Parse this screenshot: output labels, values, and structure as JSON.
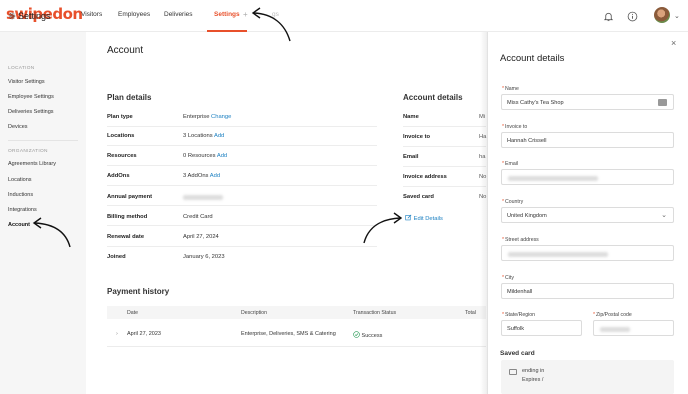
{
  "app": {
    "logo": "swipedon"
  },
  "topnav": {
    "items": [
      "Visitors",
      "Employees",
      "Deliveries",
      "Settings"
    ],
    "active": "Settings",
    "plus": "+",
    "extra": "gs"
  },
  "sidebar": {
    "title": "Settings",
    "sections": [
      {
        "heading": "LOCATION",
        "items": [
          "Visitor Settings",
          "Employee Settings",
          "Deliveries Settings",
          "Devices"
        ]
      },
      {
        "heading": "ORGANIZATION",
        "items": [
          "Agreements Library",
          "Locations",
          "Inductions",
          "Integrations",
          "Account"
        ]
      }
    ],
    "active": "Account"
  },
  "page": {
    "title": "Account"
  },
  "plan": {
    "heading": "Plan details",
    "rows": [
      {
        "label": "Plan type",
        "value": "Enterprise",
        "link": "Change"
      },
      {
        "label": "Locations",
        "value": "3 Locations",
        "link": "Add"
      },
      {
        "label": "Resources",
        "value": "0 Resources",
        "link": "Add"
      },
      {
        "label": "AddOns",
        "value": "3 AddOns",
        "link": "Add"
      },
      {
        "label": "Annual payment",
        "value": "",
        "link": ""
      },
      {
        "label": "Billing method",
        "value": "Credit Card",
        "link": ""
      },
      {
        "label": "Renewal date",
        "value": "April 27, 2024",
        "link": ""
      },
      {
        "label": "Joined",
        "value": "January 6, 2023",
        "link": ""
      }
    ]
  },
  "account": {
    "heading": "Account details",
    "rows": [
      {
        "label": "Name",
        "value": "Mi"
      },
      {
        "label": "Invoice to",
        "value": "Ha"
      },
      {
        "label": "Email",
        "value": "ha"
      },
      {
        "label": "Invoice address",
        "value": "No"
      },
      {
        "label": "Saved card",
        "value": "No"
      }
    ],
    "edit_link": "Edit Details"
  },
  "payments": {
    "heading": "Payment history",
    "columns": [
      "Date",
      "Description",
      "Transaction Status",
      "Total"
    ],
    "rows": [
      {
        "date": "April 27, 2023",
        "description": "Enterprise, Deliveries, SMS & Catering",
        "status": "Success"
      }
    ]
  },
  "drawer": {
    "title": "Account details",
    "close": "×",
    "fields": {
      "name": {
        "label": "Name",
        "value": "Miss Cathy's Tea Shop"
      },
      "invoice_to": {
        "label": "Invoice to",
        "value": "Hannah Crissell"
      },
      "email": {
        "label": "Email",
        "value": ""
      },
      "country": {
        "label": "Country",
        "value": "United Kingdom"
      },
      "street": {
        "label": "Street address",
        "value": ""
      },
      "city": {
        "label": "City",
        "value": "Mildenhall"
      },
      "state": {
        "label": "State/Region",
        "value": "Suffolk"
      },
      "zip": {
        "label": "Zip/Postal code",
        "value": ""
      }
    },
    "saved_card": {
      "heading": "Saved card",
      "line1": "ending in",
      "line2": "Expires /"
    }
  },
  "colors": {
    "brand": "#e8502b",
    "link": "#1a7fc1",
    "success": "#2e9e5b"
  }
}
